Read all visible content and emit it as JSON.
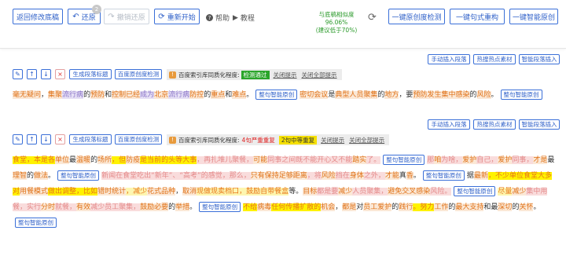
{
  "toolbar": {
    "back_label": "返回修改底稿",
    "undo_label": "还原",
    "undo_badge": "2",
    "redo_label": "撤销还原",
    "restart_label": "重新开始",
    "help_label": "帮助",
    "tutorial_label": "教程",
    "similarity_line1": "与底稿相似度 96.06%",
    "similarity_line2": "(建议低于70%)",
    "check_label": "一键原创度检测",
    "restructure_label": "一键句式重构",
    "smart_label": "一键智能原创"
  },
  "colors": {
    "accent": "#3a6fd8",
    "green": "#2aa52a",
    "orange": "#e8751a",
    "pink": "#e48a8a",
    "yellow": "#fff200"
  },
  "side_buttons": {
    "manual": "手动插入段落",
    "hot": "热搜热点素材",
    "smart": "智能段落插入"
  },
  "para_tools": {
    "edit_icon": "✎",
    "up_icon": "↑",
    "down_icon": "↓",
    "close_icon": "×",
    "gen_label": "生成段落标题",
    "detect_label": "百度原创度检测",
    "info_prefix": "百度索引库同质化程度:",
    "ignore": "关闭提示",
    "ignore_all": "关闭全部提示"
  },
  "p1": {
    "status": "检测通过",
    "text": [
      {
        "t": "毫无疑问",
        "c": "o"
      },
      {
        "t": "，",
        "c": ""
      },
      {
        "t": "集聚",
        "c": "o"
      },
      {
        "t": "流行病",
        "c": "u"
      },
      {
        "t": "的",
        "c": ""
      },
      {
        "t": "预防",
        "c": "o"
      },
      {
        "t": "和",
        "c": ""
      },
      {
        "t": "控制",
        "c": "o"
      },
      {
        "t": "已经",
        "c": "o"
      },
      {
        "t": "成为",
        "c": "u"
      },
      {
        "t": "北京",
        "c": "o"
      },
      {
        "t": "流行病",
        "c": "u"
      },
      {
        "t": "防控",
        "c": "o"
      },
      {
        "t": "的",
        "c": ""
      },
      {
        "t": "重点",
        "c": "o"
      },
      {
        "t": "和",
        "c": ""
      },
      {
        "t": "难点",
        "c": "o"
      },
      {
        "t": "。",
        "c": ""
      },
      {
        "t": "整句智能原创",
        "c": "btn"
      },
      {
        "t": "密切",
        "c": "o"
      },
      {
        "t": "会议",
        "c": "o"
      },
      {
        "t": "是",
        "c": ""
      },
      {
        "t": "典型",
        "c": "o"
      },
      {
        "t": "人员",
        "c": "o"
      },
      {
        "t": "聚集",
        "c": "o"
      },
      {
        "t": "的",
        "c": ""
      },
      {
        "t": "地方",
        "c": "o"
      },
      {
        "t": "，",
        "c": ""
      },
      {
        "t": "要",
        "c": ""
      },
      {
        "t": "预防",
        "c": "o"
      },
      {
        "t": "发生",
        "c": "o"
      },
      {
        "t": "集中",
        "c": "o"
      },
      {
        "t": "感染",
        "c": "o"
      },
      {
        "t": "的",
        "c": ""
      },
      {
        "t": "风险",
        "c": "o"
      },
      {
        "t": "。",
        "c": ""
      },
      {
        "t": "整句智能原创",
        "c": "btn"
      }
    ]
  },
  "p2": {
    "severe": "4句严重重复",
    "medium": "2句中等重复",
    "text": [
      {
        "t": "食堂，本是各",
        "c": "y"
      },
      {
        "t": "单位",
        "c": "o"
      },
      {
        "t": "最",
        "c": ""
      },
      {
        "t": "温暖",
        "c": "o"
      },
      {
        "t": "的",
        "c": ""
      },
      {
        "t": "场所",
        "c": "o"
      },
      {
        "t": "，但",
        "c": "y"
      },
      {
        "t": "防疫",
        "c": "o"
      },
      {
        "t": "是当前的",
        "c": "y"
      },
      {
        "t": "头等大事",
        "c": "y"
      },
      {
        "t": "，再扎堆儿聚餐，",
        "c": "p"
      },
      {
        "t": "可能",
        "c": "o"
      },
      {
        "t": "同事之间既不能开心又不能",
        "c": "p"
      },
      {
        "t": "踏实",
        "c": "o"
      },
      {
        "t": "了。",
        "c": "p"
      },
      {
        "t": "整句智能原创",
        "c": "btn"
      },
      {
        "t": "那",
        "c": "p"
      },
      {
        "t": "咱",
        "c": "o"
      },
      {
        "t": "为啥，",
        "c": "p"
      },
      {
        "t": "爱护",
        "c": "o"
      },
      {
        "t": "自己，",
        "c": "p"
      },
      {
        "t": "爱护",
        "c": "o"
      },
      {
        "t": "同事，",
        "c": "p"
      },
      {
        "t": "才是",
        "c": "o"
      },
      {
        "t": "最",
        "c": ""
      },
      {
        "t": "理智",
        "c": "o"
      },
      {
        "t": "的",
        "c": ""
      },
      {
        "t": "做法",
        "c": "o"
      },
      {
        "t": "。",
        "c": ""
      },
      {
        "t": "整句智能原创",
        "c": "btn"
      },
      {
        "t": "新闻在食堂吃出“新年”、“高考”的感觉，那么，",
        "c": "p"
      },
      {
        "t": "只有",
        "c": "o"
      },
      {
        "t": "保持",
        "c": "o"
      },
      {
        "t": "足够",
        "c": "o"
      },
      {
        "t": "距离",
        "c": "o"
      },
      {
        "t": "，将",
        "c": "p"
      },
      {
        "t": "风险",
        "c": "o"
      },
      {
        "t": "挡在",
        "c": "p"
      },
      {
        "t": "身体",
        "c": "o"
      },
      {
        "t": "之外，",
        "c": "p"
      },
      {
        "t": "才能",
        "c": "o"
      },
      {
        "t": "真",
        "c": ""
      },
      {
        "t": "香",
        "c": "o"
      },
      {
        "t": "。",
        "c": ""
      },
      {
        "t": "整句智能原创",
        "c": "btn"
      },
      {
        "t": "据",
        "c": ""
      },
      {
        "t": "最新",
        "c": "o"
      },
      {
        "t": "，不少",
        "c": "y"
      },
      {
        "t": "单位食堂大多对",
        "c": "y"
      },
      {
        "t": "用餐",
        "c": "o"
      },
      {
        "t": "模式",
        "c": "o"
      },
      {
        "t": "做出调整，比如",
        "c": "y"
      },
      {
        "t": "错时",
        "c": "o"
      },
      {
        "t": "统计",
        "c": "o"
      },
      {
        "t": "，减少",
        "c": "yo"
      },
      {
        "t": "花式",
        "c": "o"
      },
      {
        "t": "品种",
        "c": "o"
      },
      {
        "t": "，",
        "c": ""
      },
      {
        "t": "取消",
        "c": "o"
      },
      {
        "t": "现做现卖档口，鼓励自带餐盒",
        "c": "yo"
      },
      {
        "t": "等。",
        "c": ""
      },
      {
        "t": "目标",
        "c": "o"
      },
      {
        "t": "都是要",
        "c": "p"
      },
      {
        "t": "减少",
        "c": "o"
      },
      {
        "t": "人员聚集，",
        "c": "p"
      },
      {
        "t": "避免",
        "c": "o"
      },
      {
        "t": "交叉",
        "c": "o"
      },
      {
        "t": "感染",
        "c": "o"
      },
      {
        "t": "风险。",
        "c": "p"
      },
      {
        "t": "整句智能原创",
        "c": "btn"
      },
      {
        "t": "尽量",
        "c": "yo"
      },
      {
        "t": "减少",
        "c": "o"
      },
      {
        "t": "集中用餐，实行",
        "c": "p"
      },
      {
        "t": "分时",
        "c": "o"
      },
      {
        "t": "就餐，",
        "c": "p"
      },
      {
        "t": "有效",
        "c": "o"
      },
      {
        "t": "减少员工聚集，",
        "c": "p"
      },
      {
        "t": "鼓励",
        "c": "o"
      },
      {
        "t": "必要",
        "c": "o"
      },
      {
        "t": "的",
        "c": ""
      },
      {
        "t": "举措",
        "c": "o"
      },
      {
        "t": "。",
        "c": ""
      },
      {
        "t": "整句智能原创",
        "c": "btn"
      },
      {
        "t": "不给",
        "c": "y"
      },
      {
        "t": "病毒",
        "c": "o"
      },
      {
        "t": "任何传播扩散的",
        "c": "y"
      },
      {
        "t": "机会",
        "c": "o"
      },
      {
        "t": "，",
        "c": ""
      },
      {
        "t": "都是",
        "c": "o"
      },
      {
        "t": "对",
        "c": ""
      },
      {
        "t": "员工",
        "c": "o"
      },
      {
        "t": "爱护",
        "c": "o"
      },
      {
        "t": "的",
        "c": ""
      },
      {
        "t": "践行",
        "c": "o"
      },
      {
        "t": "。努力",
        "c": "y"
      },
      {
        "t": "工作",
        "c": "o"
      },
      {
        "t": "的",
        "c": ""
      },
      {
        "t": "最大",
        "c": "o"
      },
      {
        "t": "支持",
        "c": "o"
      },
      {
        "t": "和最",
        "c": ""
      },
      {
        "t": "深切",
        "c": "o"
      },
      {
        "t": "的",
        "c": ""
      },
      {
        "t": "关怀",
        "c": "o"
      },
      {
        "t": "。",
        "c": ""
      },
      {
        "t": "整句智能原创",
        "c": "btn"
      }
    ]
  }
}
